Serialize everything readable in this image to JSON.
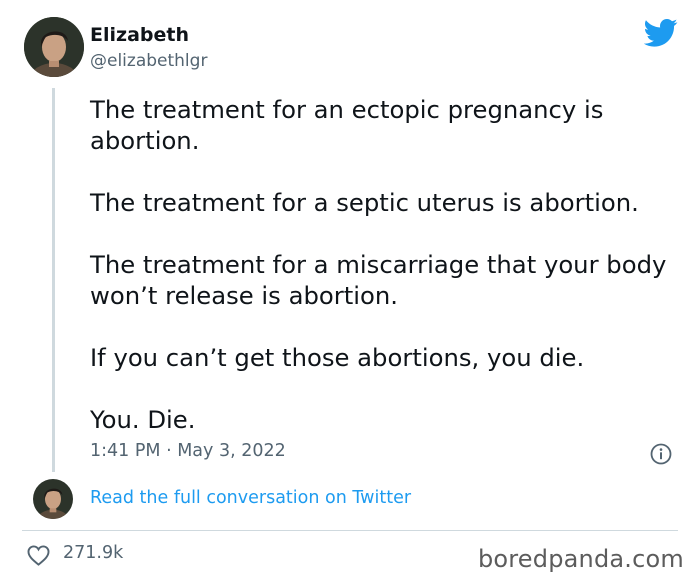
{
  "author": {
    "name": "Elizabeth",
    "handle": "@elizabethlgr",
    "avatar_icon": "avatar-portrait"
  },
  "brand": {
    "logo_icon": "twitter-bird-icon",
    "accent_color": "#1d9bf0"
  },
  "tweet": {
    "paragraphs": [
      "The treatment for an ectopic pregnancy is abortion.",
      "The treatment for a septic uterus is abortion.",
      "The treatment for a miscarriage that your body won’t release is abortion.",
      "If you can’t get those abortions, you die.",
      "You. Die."
    ],
    "timestamp": "1:41 PM · May 3, 2022",
    "info_icon": "info-icon"
  },
  "conversation": {
    "link_text": "Read the full conversation on Twitter"
  },
  "engagement": {
    "like_icon": "heart-icon",
    "like_count": "271.9k"
  },
  "watermark": {
    "text": "boredpanda.com"
  }
}
